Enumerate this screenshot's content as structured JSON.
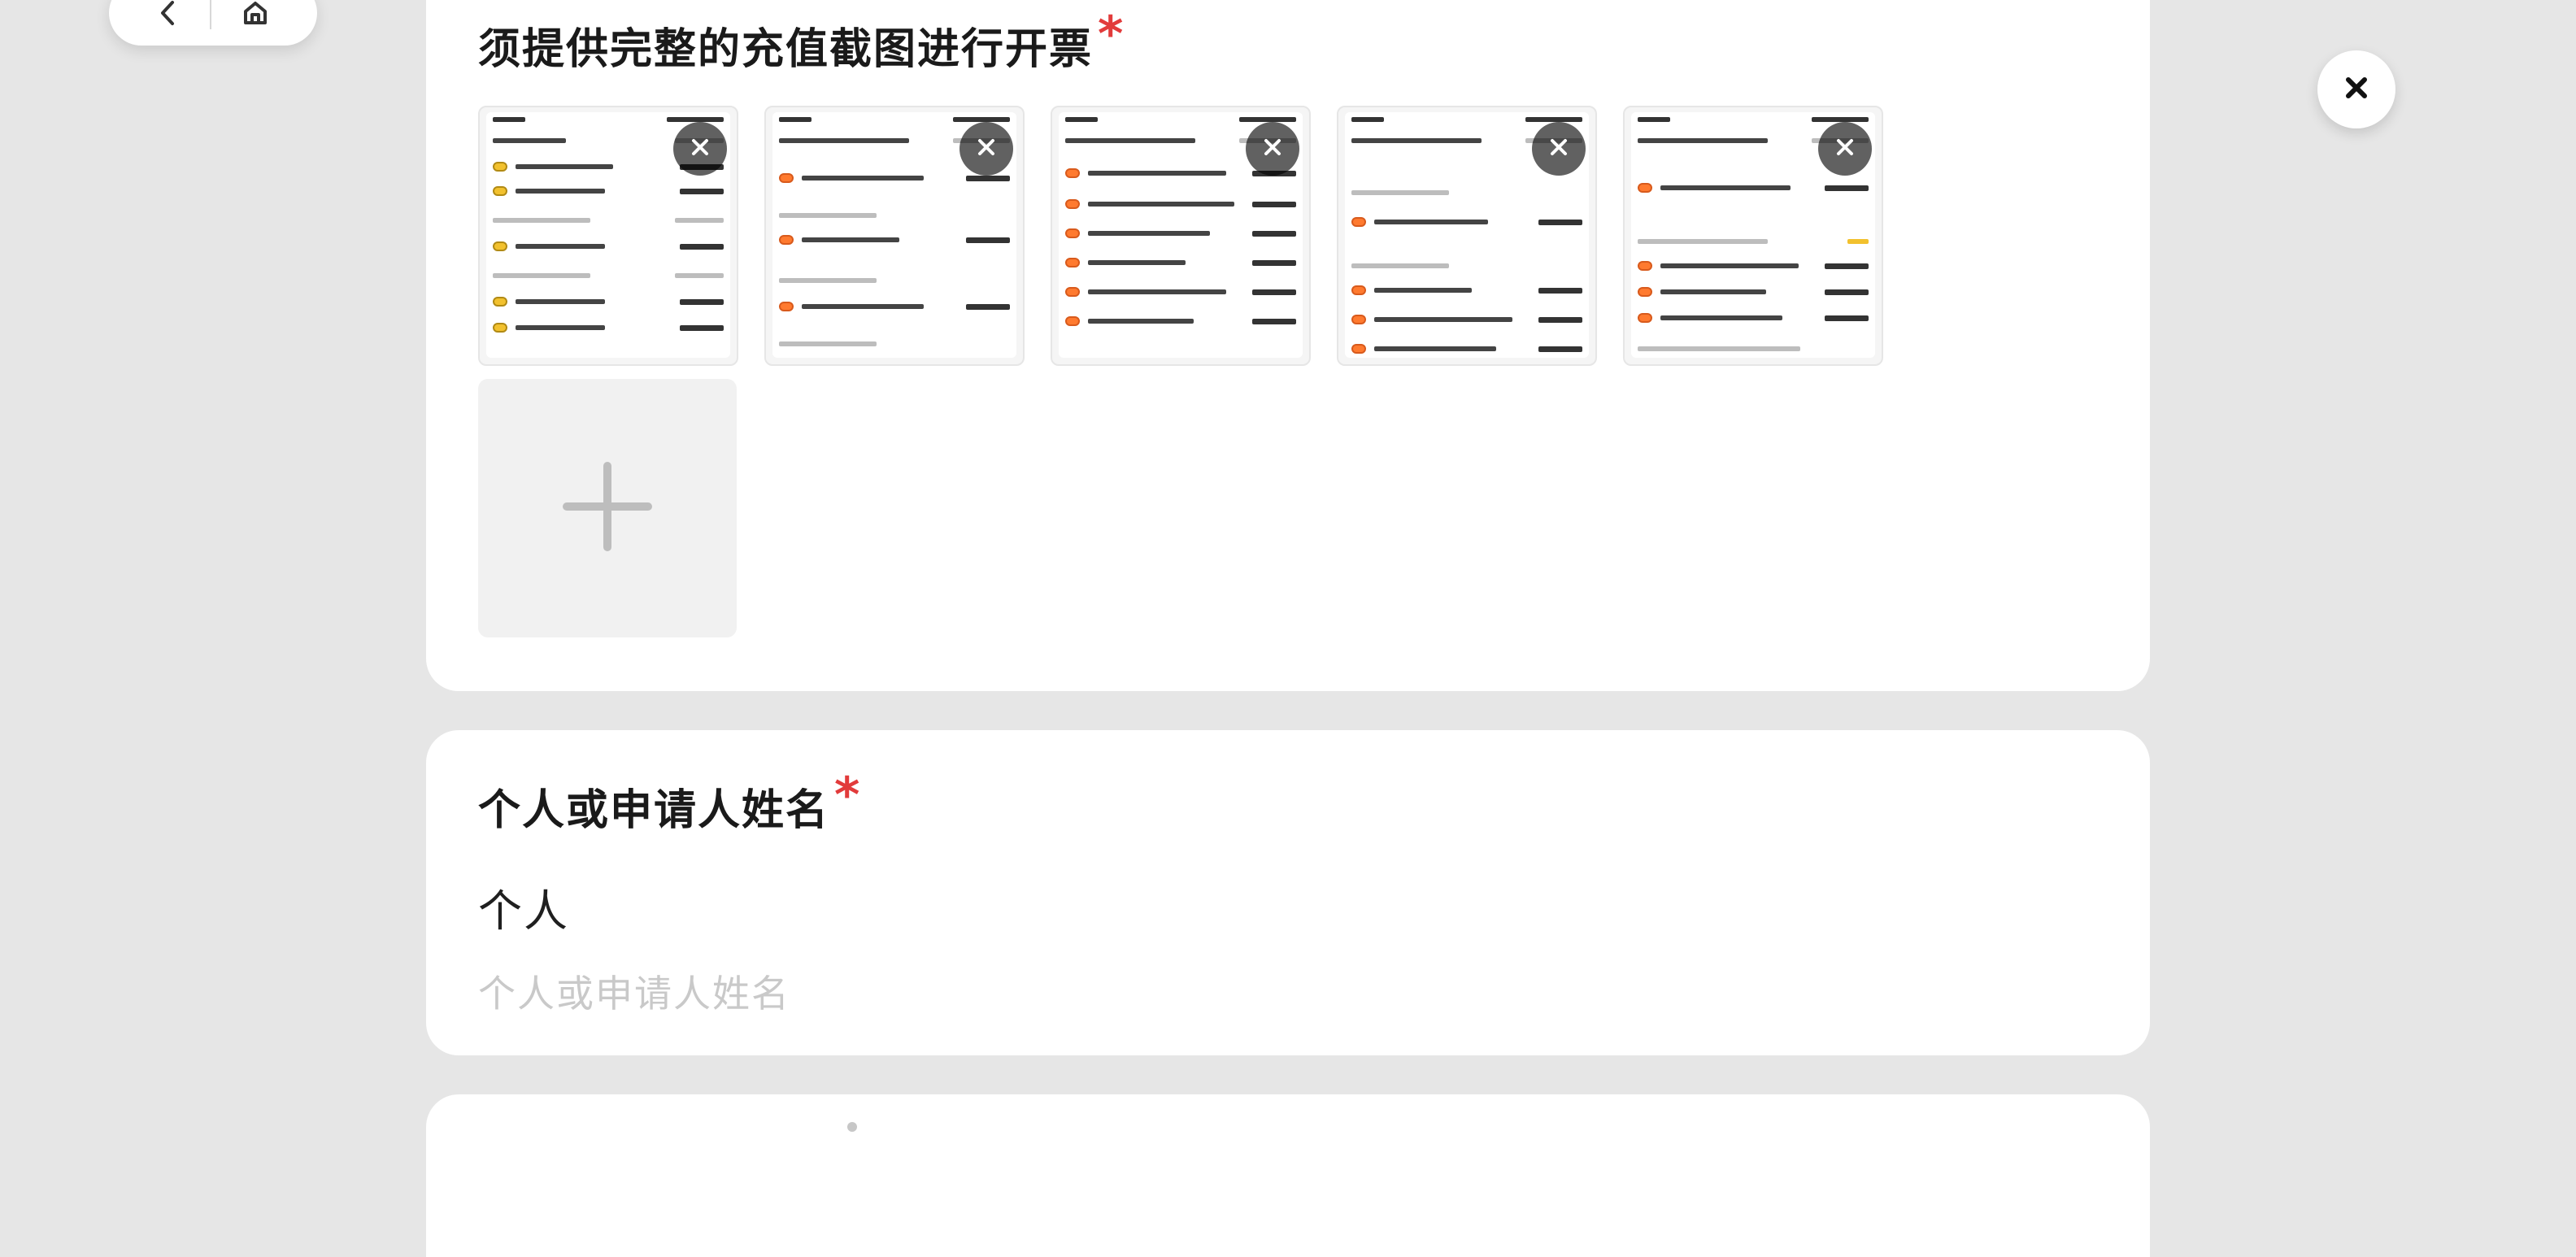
{
  "screen": {
    "background": "#E6E6E6"
  },
  "icons": {
    "back": "chevron-left-icon",
    "capsule_action": "home-icon",
    "close": "close-icon",
    "thumb_remove": "close-icon",
    "add": "plus-icon"
  },
  "section_receipts": {
    "title": "须提供完整的充值截图进行开票",
    "required_mark": "*",
    "thumbnails": [
      {
        "name": "thumb-1"
      },
      {
        "name": "thumb-2"
      },
      {
        "name": "thumb-3"
      },
      {
        "name": "thumb-4"
      },
      {
        "name": "thumb-5"
      }
    ]
  },
  "section_name": {
    "title": "个人或申请人姓名",
    "required_mark": "*",
    "selected_value": "个人",
    "input_placeholder": "个人或申请人姓名",
    "input_value": ""
  },
  "colors": {
    "required": "#E23B3B",
    "accent_orange": "#FF7A2F"
  }
}
